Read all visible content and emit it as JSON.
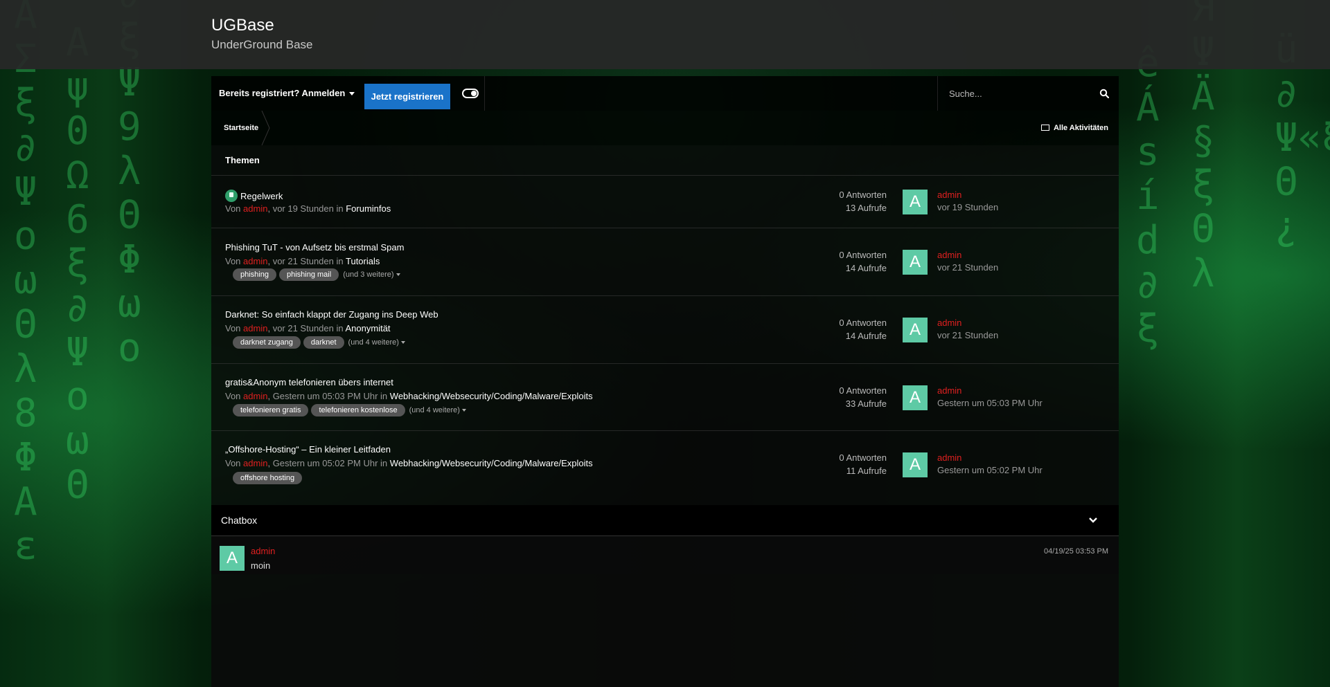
{
  "site": {
    "title": "UGBase",
    "subtitle": "UnderGround Base"
  },
  "nav": {
    "login_label": "Bereits registriert? Anmelden",
    "register_label": "Jetzt registrieren",
    "search_placeholder": "Suche..."
  },
  "breadcrumb": {
    "home": "Startseite",
    "all_activity": "Alle Aktivitäten"
  },
  "topics_panel": {
    "title": "Themen",
    "topics": [
      {
        "title": "Regelwerk",
        "pinned": true,
        "by": "Von",
        "author": "admin",
        "time": ", vor 19 Stunden in",
        "forum": "Foruminfos",
        "tags": [],
        "more": "",
        "replies": "0 Antworten",
        "views": "13 Aufrufe",
        "avatar_letter": "A",
        "last_author": "admin",
        "last_time": "vor 19 Stunden"
      },
      {
        "title": "Phishing TuT - von Aufsetz bis erstmal Spam",
        "pinned": false,
        "by": "Von",
        "author": "admin",
        "time": ", vor 21 Stunden in",
        "forum": "Tutorials",
        "tags": [
          "phishing",
          "phishing mail"
        ],
        "more": "(und 3 weitere)",
        "replies": "0 Antworten",
        "views": "14 Aufrufe",
        "avatar_letter": "A",
        "last_author": "admin",
        "last_time": "vor 21 Stunden"
      },
      {
        "title": "Darknet: So einfach klappt der Zugang ins Deep Web",
        "pinned": false,
        "by": "Von",
        "author": "admin",
        "time": ", vor 21 Stunden in",
        "forum": "Anonymität",
        "tags": [
          "darknet zugang",
          "darknet"
        ],
        "more": "(und 4 weitere)",
        "replies": "0 Antworten",
        "views": "14 Aufrufe",
        "avatar_letter": "A",
        "last_author": "admin",
        "last_time": "vor 21 Stunden"
      },
      {
        "title": "gratis&Anonym telefonieren übers internet",
        "pinned": false,
        "by": "Von",
        "author": "admin",
        "time": ", Gestern um 05:03 PM Uhr in",
        "forum": "Webhacking/Websecurity/Coding/Malware/Exploits",
        "tags": [
          "telefonieren gratis",
          "telefonieren kostenlose"
        ],
        "more": "(und 4 weitere)",
        "replies": "0 Antworten",
        "views": "33 Aufrufe",
        "avatar_letter": "A",
        "last_author": "admin",
        "last_time": "Gestern um 05:03 PM Uhr"
      },
      {
        "title": "„Offshore-Hosting“ – Ein kleiner Leitfaden",
        "pinned": false,
        "by": "Von",
        "author": "admin",
        "time": ", Gestern um 05:02 PM Uhr in",
        "forum": "Webhacking/Websecurity/Coding/Malware/Exploits",
        "tags": [
          "offshore hosting"
        ],
        "more": "",
        "replies": "0 Antworten",
        "views": "11 Aufrufe",
        "avatar_letter": "A",
        "last_author": "admin",
        "last_time": "Gestern um 05:02 PM Uhr"
      }
    ]
  },
  "chatbox": {
    "title": "Chatbox",
    "messages": [
      {
        "avatar_letter": "A",
        "user": "admin",
        "text": "moin",
        "time": "04/19/25 03:53 PM"
      }
    ]
  },
  "colors": {
    "accent": "#1a73c9",
    "author": "#e02020",
    "avatar": "#5ecaa5",
    "pin": "#2f9e6a"
  }
}
